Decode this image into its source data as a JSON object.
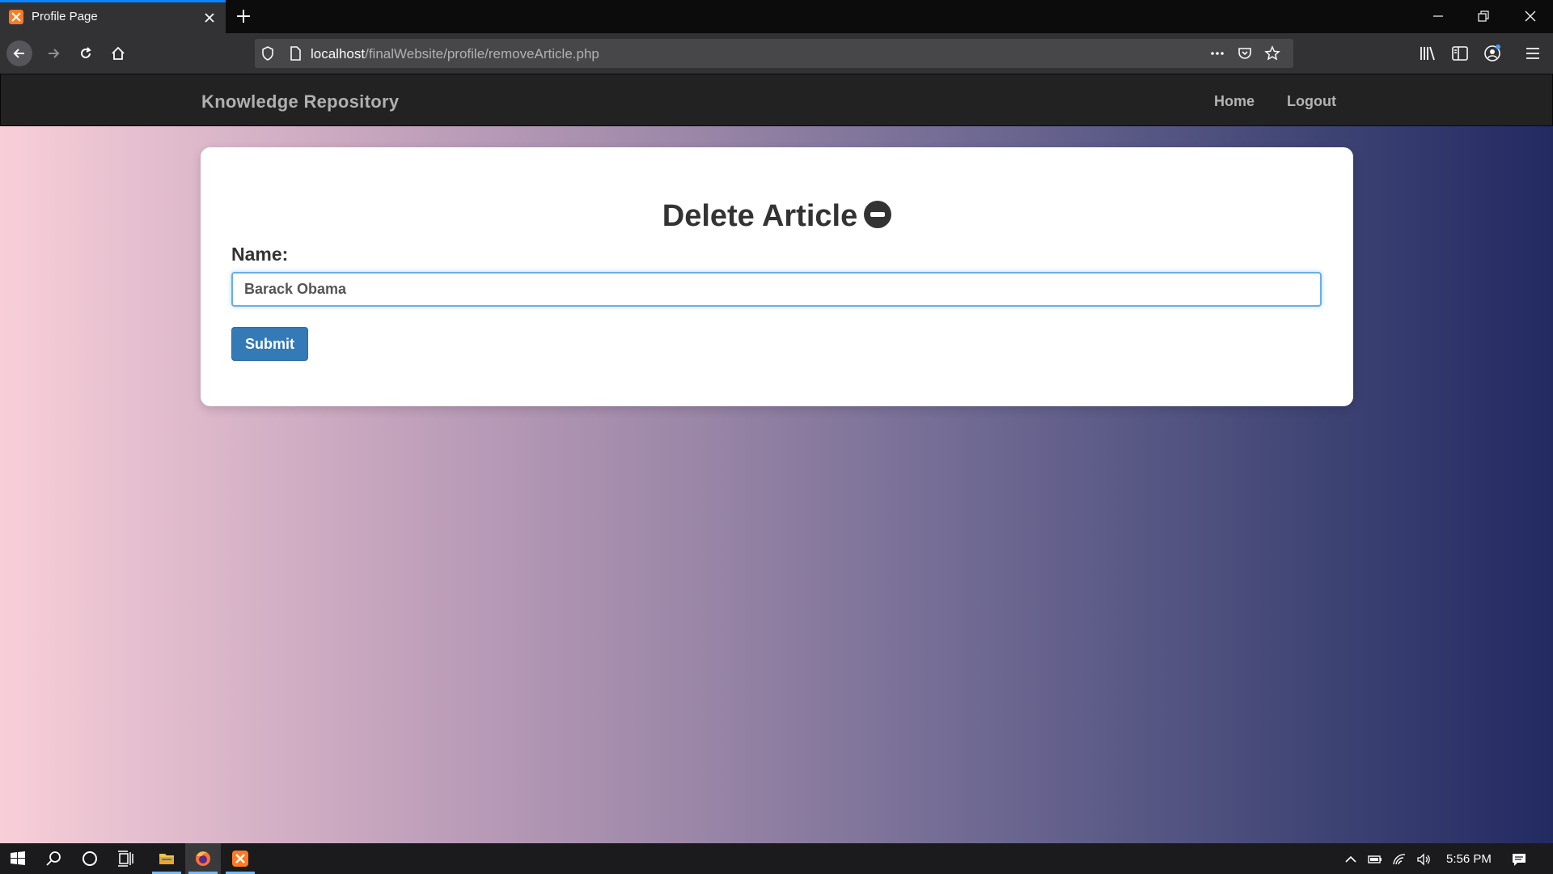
{
  "browser": {
    "tab_title": "Profile Page",
    "url_host": "localhost",
    "url_path": "/finalWebsite/profile/removeArticle.php"
  },
  "site": {
    "brand": "Knowledge Repository",
    "nav": {
      "home": "Home",
      "logout": "Logout"
    }
  },
  "form": {
    "title": "Delete Article",
    "name_label": "Name:",
    "name_value": "Barack Obama",
    "submit_label": "Submit"
  },
  "taskbar": {
    "clock": "5:56 PM"
  },
  "colors": {
    "accent": "#337ab7",
    "navbar": "#222222",
    "gradient_start": "#f8cfd9",
    "gradient_end": "#232a62"
  }
}
